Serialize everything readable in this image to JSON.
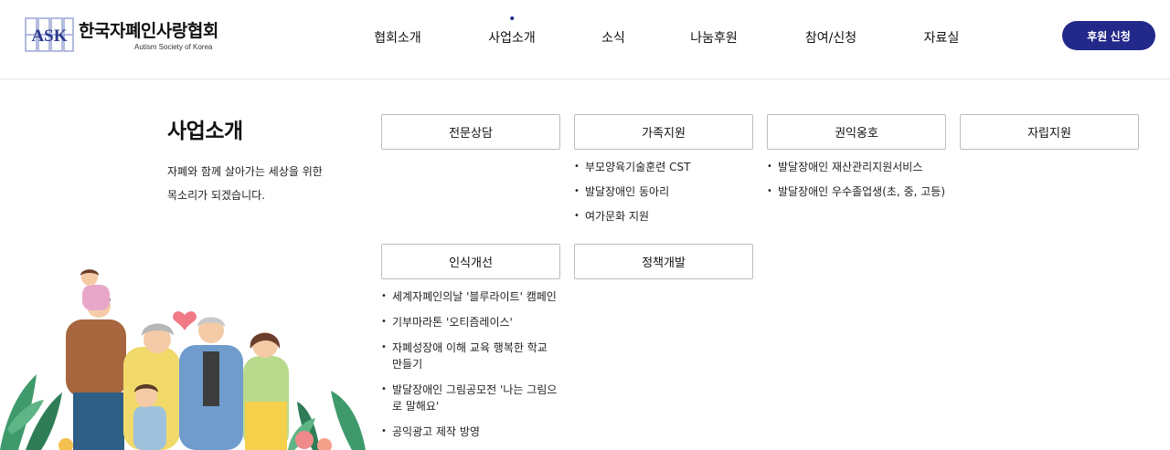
{
  "brand": {
    "mark_text": "ASK",
    "title": "한국자폐인사랑협회",
    "subtitle": "Autism Society of Korea"
  },
  "nav": {
    "items": [
      {
        "label": "협회소개"
      },
      {
        "label": "사업소개"
      },
      {
        "label": "소식"
      },
      {
        "label": "나눔후원"
      },
      {
        "label": "참여/신청"
      },
      {
        "label": "자료실"
      }
    ],
    "active_index": 1
  },
  "donate_button": "후원 신청",
  "intro": {
    "title": "사업소개",
    "desc_line1": "자폐와 함께 살아가는 세상을 위한",
    "desc_line2": "목소리가 되겠습니다."
  },
  "categories": [
    {
      "label": "전문상담",
      "items": []
    },
    {
      "label": "가족지원",
      "items": [
        "부모양육기술훈련 CST",
        "발달장애인 동아리",
        "여가문화 지원"
      ]
    },
    {
      "label": "권익옹호",
      "items": [
        "발달장애인 재산관리지원서비스",
        "발달장애인 우수졸업생(초, 중, 고등)"
      ]
    },
    {
      "label": "자립지원",
      "items": []
    },
    {
      "label": "인식개선",
      "items": [
        "세계자폐인의날 '블루라이트' 캠페인",
        "기부마라톤 '오티즘레이스'",
        "자폐성장애 이해 교육 행복한 학교 만들기",
        "발달장애인 그림공모전 '나는 그림으로 말해요'",
        "공익광고 제작 방영"
      ]
    },
    {
      "label": "정책개발",
      "items": []
    }
  ],
  "colors": {
    "accent": "#23298a",
    "logo_blue": "#2b3a8f",
    "border": "#bdbdbd"
  },
  "icons": {
    "logo": "ask-logo-icon",
    "illustration": "family-illustration"
  }
}
